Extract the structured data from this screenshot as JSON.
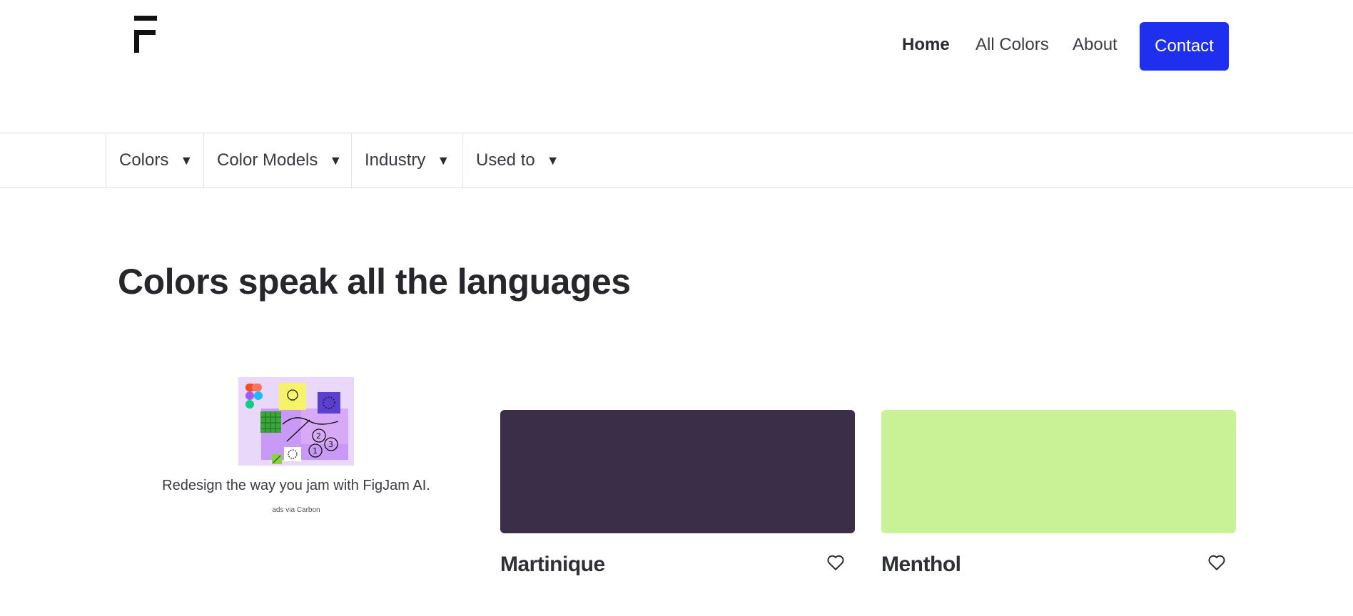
{
  "header": {
    "logo_icon": "f-logo-icon",
    "nav": [
      {
        "label": "Home",
        "active": true
      },
      {
        "label": "All Colors",
        "active": false
      },
      {
        "label": "About",
        "active": false
      }
    ],
    "contact_label": "Contact",
    "contact_color": "#1f2ff0"
  },
  "filters": [
    {
      "label": "Colors",
      "icon": "caret-down-icon"
    },
    {
      "label": "Color Models",
      "icon": "caret-down-icon"
    },
    {
      "label": "Industry",
      "icon": "caret-down-icon"
    },
    {
      "label": "Used to",
      "icon": "caret-down-icon"
    }
  ],
  "arrow_glyph": "▼",
  "headline": "Colors speak all the languages",
  "ad": {
    "image": "figjam-ad-illustration",
    "text": "Redesign the way you jam with FigJam AI.",
    "via": "ads via Carbon"
  },
  "colors": [
    {
      "name": "Martinique",
      "hex": "#3a2e48",
      "icon": "heart-outline-icon"
    },
    {
      "name": "Menthol",
      "hex": "#c9f296",
      "icon": "heart-outline-icon"
    }
  ]
}
